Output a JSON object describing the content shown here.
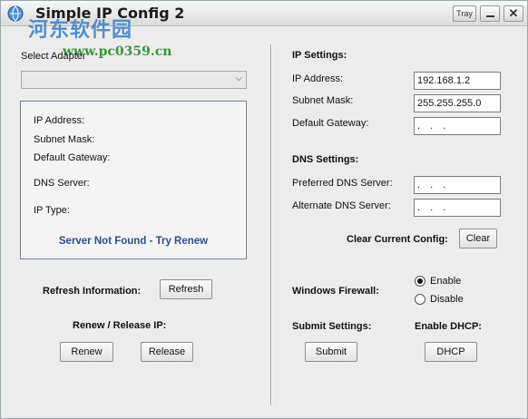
{
  "window": {
    "title": "Simple IP Config 2",
    "tray_label": "Tray",
    "close_label": "✕"
  },
  "watermark": {
    "line1": "河东软件园",
    "line2": "www.pc0359.cn"
  },
  "left": {
    "select_adapter_label": "Select Adapter",
    "adapter_value": "",
    "info": {
      "ip_label": "IP Address:",
      "subnet_label": "Subnet Mask:",
      "gateway_label": "Default Gateway:",
      "dns_label": "DNS Server:",
      "iptype_label": "IP Type:",
      "status": "Server Not Found - Try Renew"
    },
    "refresh_info_label": "Refresh Information:",
    "refresh_button": "Refresh",
    "renew_release_label": "Renew / Release IP:",
    "renew_button": "Renew",
    "release_button": "Release"
  },
  "right": {
    "ip_settings_heading": "IP Settings:",
    "ip_address_label": "IP Address:",
    "ip_address_value": "192.168.1.2",
    "subnet_label": "Subnet Mask:",
    "subnet_value": "255.255.255.0",
    "gateway_label": "Default Gateway:",
    "gateway_value": ". . .",
    "dns_settings_heading": "DNS Settings:",
    "preferred_dns_label": "Preferred DNS Server:",
    "preferred_dns_value": ". . .",
    "alternate_dns_label": "Alternate DNS Server:",
    "alternate_dns_value": ". . .",
    "clear_config_label": "Clear Current Config:",
    "clear_button": "Clear",
    "firewall_label": "Windows Firewall:",
    "enable_label": "Enable",
    "disable_label": "Disable",
    "firewall_selected": "Enable",
    "submit_settings_label": "Submit Settings:",
    "submit_button": "Submit",
    "enable_dhcp_label": "Enable DHCP:",
    "dhcp_button": "DHCP"
  }
}
